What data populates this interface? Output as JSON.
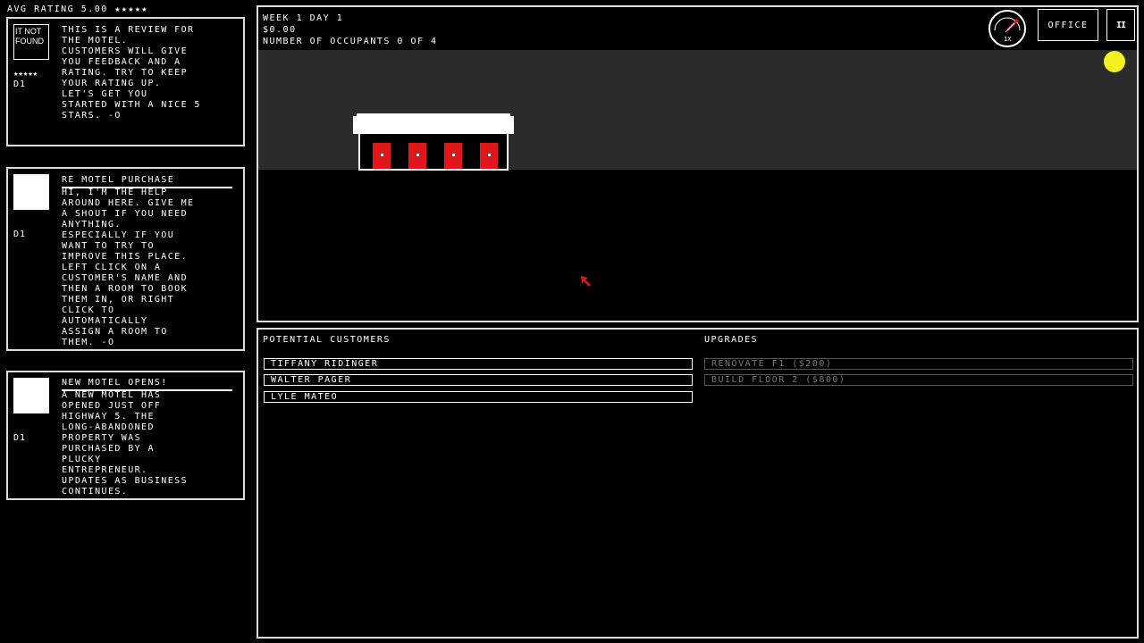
{
  "rating_header": {
    "label": "AVG RATING 5.00 ★★★★★"
  },
  "messages": [
    {
      "image_text": "IT NOT FOUND",
      "stars": "★★★★★",
      "day": "D1",
      "title": "",
      "body": "THIS IS A REVIEW FOR\nTHE MOTEL.\nCUSTOMERS WILL GIVE\nYOU FEEDBACK AND A\nRATING. TRY TO KEEP\nYOUR RATING UP.\nLET'S GET YOU\nSTARTED WITH A NICE 5\nSTARS. -O"
    },
    {
      "day": "D1",
      "title": "RE MOTEL PURCHASE",
      "body": "HI, I'M THE HELP\nAROUND HERE. GIVE ME\nA SHOUT IF YOU NEED\nANYTHING.\nESPECIALLY IF YOU\nWANT TO TRY TO\nIMPROVE THIS PLACE.\nLEFT CLICK ON A\nCUSTOMER'S NAME AND\nTHEN A ROOM TO BOOK\nTHEM IN, OR RIGHT\nCLICK TO\nAUTOMATICALLY\nASSIGN A ROOM TO\nTHEM. -O"
    },
    {
      "day": "D1",
      "title": "NEW MOTEL OPENS!",
      "body": "A NEW MOTEL HAS\nOPENED JUST OFF\nHIGHWAY 5. THE\nLONG-ABANDONED\nPROPERTY WAS\nPURCHASED BY A\nPLUCKY\nENTREPRENEUR.\nUPDATES AS BUSINESS\nCONTINUES."
    }
  ],
  "hud": {
    "week_day": "WEEK 1 DAY 1",
    "money": "$0.00",
    "occupants": "NUMBER OF OCCUPANTS 0 OF 4",
    "dial_label": "1X",
    "office_label": "OFFICE",
    "pause_label": "II"
  },
  "colors": {
    "sky": "#2b2b2b",
    "sun": "#f2f01e",
    "door": "#e0161b",
    "cursor": "#e0161b"
  },
  "customers": {
    "title": "POTENTIAL CUSTOMERS",
    "items": [
      "TIFFANY RIDINGER",
      "WALTER PAGER",
      "LYLE MATEO"
    ]
  },
  "upgrades": {
    "title": "UPGRADES",
    "items": [
      "RENOVATE F1 ($200)",
      "BUILD FLOOR 2 ($800)"
    ]
  }
}
